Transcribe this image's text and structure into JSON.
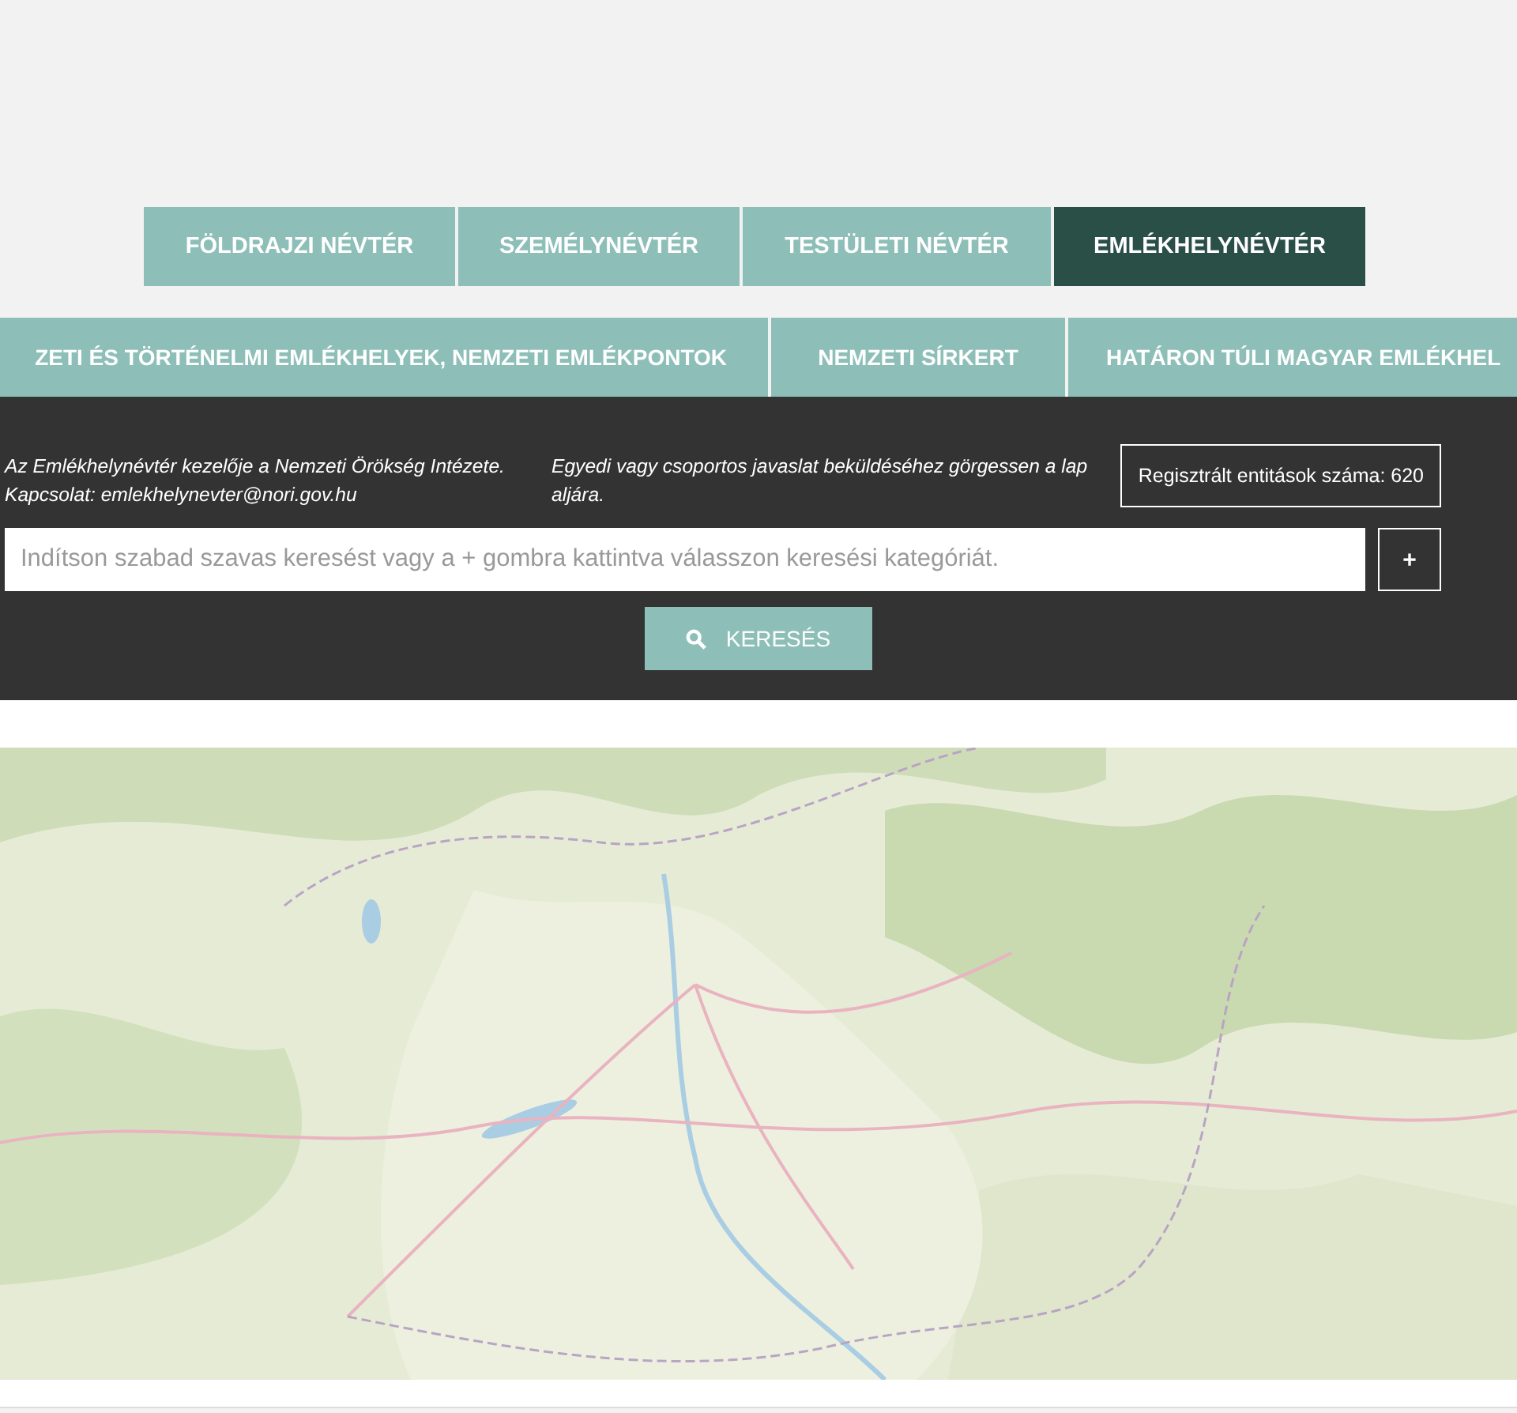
{
  "main_tabs": [
    {
      "label": "FÖLDRAJZI NÉVTÉR",
      "selected": false
    },
    {
      "label": "SZEMÉLYNÉVTÉR",
      "selected": false
    },
    {
      "label": "TESTÜLETI NÉVTÉR",
      "selected": false
    },
    {
      "label": "EMLÉKHELYNÉVTÉR",
      "selected": true
    }
  ],
  "sub_tabs": [
    {
      "label": "ZETI ÉS TÖRTÉNELMI EMLÉKHELYEK, NEMZETI EMLÉKPONTOK"
    },
    {
      "label": "NEMZETI SÍRKERT"
    },
    {
      "label": "HATÁRON TÚLI MAGYAR EMLÉKHEL"
    }
  ],
  "info": {
    "maintainer": "Az Emlékhelynévtér kezelője a Nemzeti Örökség Intézete.",
    "contact": "Kapcsolat: emlekhelynevter@nori.gov.hu",
    "suggestion": "Egyedi vagy csoportos javaslat beküldéséhez görgessen a lap aljára.",
    "count": "Regisztrált entitások száma: 620"
  },
  "search": {
    "placeholder": "Indítson szabad szavas keresést vagy a + gombra kattintva válasszon keresési kategóriát.",
    "add_button": "+",
    "submit": "KERESÉS"
  }
}
